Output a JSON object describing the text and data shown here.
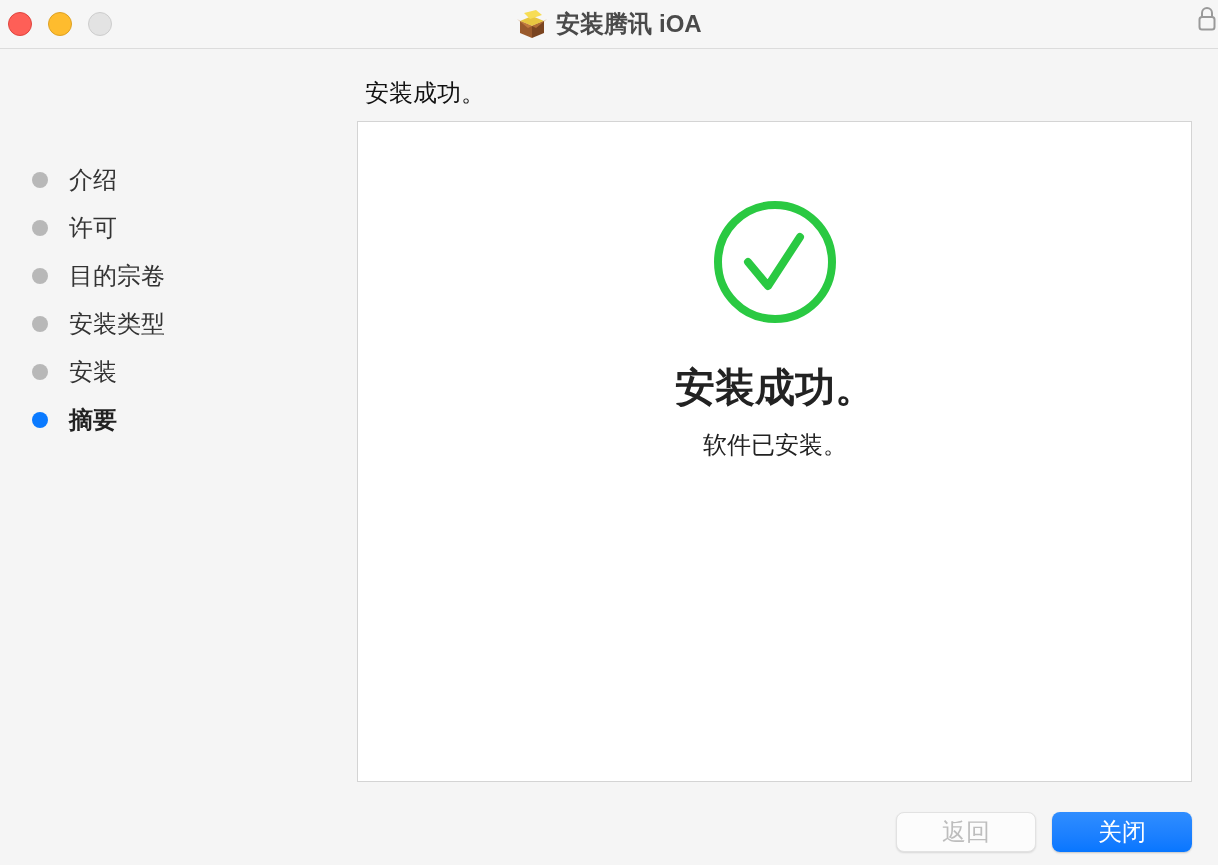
{
  "window": {
    "title": "安装腾讯 iOA",
    "controls": [
      {
        "kind": "close",
        "disabled": false
      },
      {
        "kind": "minimize",
        "disabled": false
      },
      {
        "kind": "zoom",
        "disabled": true
      }
    ]
  },
  "steps": [
    {
      "label": "介绍",
      "selected": false
    },
    {
      "label": "许可",
      "selected": false
    },
    {
      "label": "目的宗卷",
      "selected": false
    },
    {
      "label": "安装类型",
      "selected": false
    },
    {
      "label": "安装",
      "selected": false
    },
    {
      "label": "摘要",
      "selected": true
    }
  ],
  "content": {
    "heading": "安装成功。",
    "status_title": "安装成功。",
    "status_message": "软件已安装。"
  },
  "buttons": [
    {
      "label": "返回",
      "disabled": true,
      "primary": false
    },
    {
      "label": "关闭",
      "disabled": false,
      "primary": true
    }
  ]
}
